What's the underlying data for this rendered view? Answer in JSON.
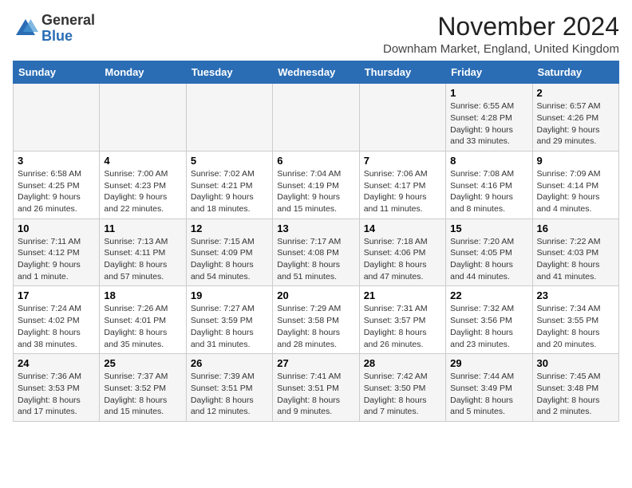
{
  "logo": {
    "general": "General",
    "blue": "Blue"
  },
  "header": {
    "month": "November 2024",
    "location": "Downham Market, England, United Kingdom"
  },
  "days_of_week": [
    "Sunday",
    "Monday",
    "Tuesday",
    "Wednesday",
    "Thursday",
    "Friday",
    "Saturday"
  ],
  "weeks": [
    [
      {
        "day": "",
        "info": ""
      },
      {
        "day": "",
        "info": ""
      },
      {
        "day": "",
        "info": ""
      },
      {
        "day": "",
        "info": ""
      },
      {
        "day": "",
        "info": ""
      },
      {
        "day": "1",
        "info": "Sunrise: 6:55 AM\nSunset: 4:28 PM\nDaylight: 9 hours and 33 minutes."
      },
      {
        "day": "2",
        "info": "Sunrise: 6:57 AM\nSunset: 4:26 PM\nDaylight: 9 hours and 29 minutes."
      }
    ],
    [
      {
        "day": "3",
        "info": "Sunrise: 6:58 AM\nSunset: 4:25 PM\nDaylight: 9 hours and 26 minutes."
      },
      {
        "day": "4",
        "info": "Sunrise: 7:00 AM\nSunset: 4:23 PM\nDaylight: 9 hours and 22 minutes."
      },
      {
        "day": "5",
        "info": "Sunrise: 7:02 AM\nSunset: 4:21 PM\nDaylight: 9 hours and 18 minutes."
      },
      {
        "day": "6",
        "info": "Sunrise: 7:04 AM\nSunset: 4:19 PM\nDaylight: 9 hours and 15 minutes."
      },
      {
        "day": "7",
        "info": "Sunrise: 7:06 AM\nSunset: 4:17 PM\nDaylight: 9 hours and 11 minutes."
      },
      {
        "day": "8",
        "info": "Sunrise: 7:08 AM\nSunset: 4:16 PM\nDaylight: 9 hours and 8 minutes."
      },
      {
        "day": "9",
        "info": "Sunrise: 7:09 AM\nSunset: 4:14 PM\nDaylight: 9 hours and 4 minutes."
      }
    ],
    [
      {
        "day": "10",
        "info": "Sunrise: 7:11 AM\nSunset: 4:12 PM\nDaylight: 9 hours and 1 minute."
      },
      {
        "day": "11",
        "info": "Sunrise: 7:13 AM\nSunset: 4:11 PM\nDaylight: 8 hours and 57 minutes."
      },
      {
        "day": "12",
        "info": "Sunrise: 7:15 AM\nSunset: 4:09 PM\nDaylight: 8 hours and 54 minutes."
      },
      {
        "day": "13",
        "info": "Sunrise: 7:17 AM\nSunset: 4:08 PM\nDaylight: 8 hours and 51 minutes."
      },
      {
        "day": "14",
        "info": "Sunrise: 7:18 AM\nSunset: 4:06 PM\nDaylight: 8 hours and 47 minutes."
      },
      {
        "day": "15",
        "info": "Sunrise: 7:20 AM\nSunset: 4:05 PM\nDaylight: 8 hours and 44 minutes."
      },
      {
        "day": "16",
        "info": "Sunrise: 7:22 AM\nSunset: 4:03 PM\nDaylight: 8 hours and 41 minutes."
      }
    ],
    [
      {
        "day": "17",
        "info": "Sunrise: 7:24 AM\nSunset: 4:02 PM\nDaylight: 8 hours and 38 minutes."
      },
      {
        "day": "18",
        "info": "Sunrise: 7:26 AM\nSunset: 4:01 PM\nDaylight: 8 hours and 35 minutes."
      },
      {
        "day": "19",
        "info": "Sunrise: 7:27 AM\nSunset: 3:59 PM\nDaylight: 8 hours and 31 minutes."
      },
      {
        "day": "20",
        "info": "Sunrise: 7:29 AM\nSunset: 3:58 PM\nDaylight: 8 hours and 28 minutes."
      },
      {
        "day": "21",
        "info": "Sunrise: 7:31 AM\nSunset: 3:57 PM\nDaylight: 8 hours and 26 minutes."
      },
      {
        "day": "22",
        "info": "Sunrise: 7:32 AM\nSunset: 3:56 PM\nDaylight: 8 hours and 23 minutes."
      },
      {
        "day": "23",
        "info": "Sunrise: 7:34 AM\nSunset: 3:55 PM\nDaylight: 8 hours and 20 minutes."
      }
    ],
    [
      {
        "day": "24",
        "info": "Sunrise: 7:36 AM\nSunset: 3:53 PM\nDaylight: 8 hours and 17 minutes."
      },
      {
        "day": "25",
        "info": "Sunrise: 7:37 AM\nSunset: 3:52 PM\nDaylight: 8 hours and 15 minutes."
      },
      {
        "day": "26",
        "info": "Sunrise: 7:39 AM\nSunset: 3:51 PM\nDaylight: 8 hours and 12 minutes."
      },
      {
        "day": "27",
        "info": "Sunrise: 7:41 AM\nSunset: 3:51 PM\nDaylight: 8 hours and 9 minutes."
      },
      {
        "day": "28",
        "info": "Sunrise: 7:42 AM\nSunset: 3:50 PM\nDaylight: 8 hours and 7 minutes."
      },
      {
        "day": "29",
        "info": "Sunrise: 7:44 AM\nSunset: 3:49 PM\nDaylight: 8 hours and 5 minutes."
      },
      {
        "day": "30",
        "info": "Sunrise: 7:45 AM\nSunset: 3:48 PM\nDaylight: 8 hours and 2 minutes."
      }
    ]
  ]
}
